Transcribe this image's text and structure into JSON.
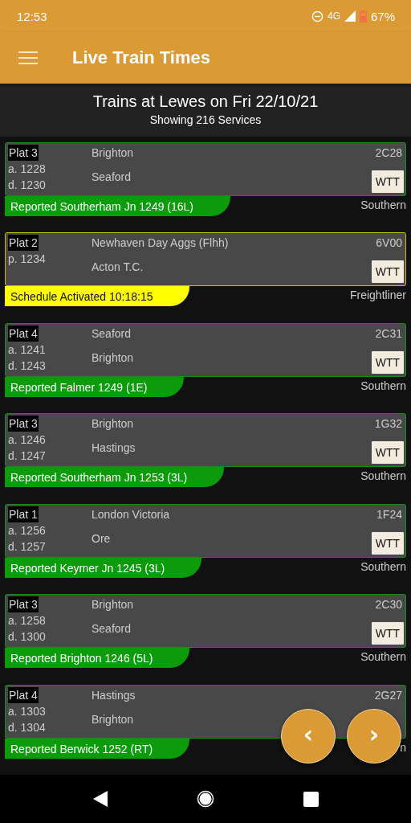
{
  "status_bar": {
    "time": "12:53",
    "network": "4G",
    "battery": "67%"
  },
  "app_bar": {
    "title": "Live Train Times"
  },
  "header": {
    "title": "Trains at Lewes on Fri 22/10/21",
    "subtitle": "Showing 216 Services"
  },
  "services": [
    {
      "platform": "Plat 3",
      "times": [
        "a. 1228",
        "d. 1230"
      ],
      "origin": "Brighton",
      "destination": "Seaford",
      "headcode": "2C28",
      "wtt": "WTT",
      "status": {
        "kind": "reported",
        "text": "Reported Southerham Jn 1249 (16L)"
      },
      "operator": "Southern"
    },
    {
      "platform": "Plat 2",
      "times": [
        "p. 1234"
      ],
      "origin": "Newhaven Day Aggs (Flhh)",
      "destination": "Acton T.C.",
      "headcode": "6V00",
      "wtt": "WTT",
      "status": {
        "kind": "activated",
        "text": "Schedule Activated 10:18:15"
      },
      "operator": "Freightliner"
    },
    {
      "platform": "Plat 4",
      "times": [
        "a. 1241",
        "d. 1243"
      ],
      "origin": "Seaford",
      "destination": "Brighton",
      "headcode": "2C31",
      "wtt": "WTT",
      "status": {
        "kind": "reported",
        "text": "Reported Falmer 1249 (1E)"
      },
      "operator": "Southern"
    },
    {
      "platform": "Plat 3",
      "times": [
        "a. 1246",
        "d. 1247"
      ],
      "origin": "Brighton",
      "destination": "Hastings",
      "headcode": "1G32",
      "wtt": "WTT",
      "status": {
        "kind": "reported",
        "text": "Reported Southerham Jn 1253 (3L)"
      },
      "operator": "Southern"
    },
    {
      "platform": "Plat 1",
      "times": [
        "a. 1256",
        "d. 1257"
      ],
      "origin": "London Victoria",
      "destination": "Ore",
      "headcode": "1F24",
      "wtt": "WTT",
      "status": {
        "kind": "reported",
        "text": "Reported Keymer Jn 1245 (3L)"
      },
      "operator": "Southern"
    },
    {
      "platform": "Plat 3",
      "times": [
        "a. 1258",
        "d. 1300"
      ],
      "origin": "Brighton",
      "destination": "Seaford",
      "headcode": "2C30",
      "wtt": "WTT",
      "status": {
        "kind": "reported",
        "text": "Reported Brighton 1246 (5L)"
      },
      "operator": "Southern"
    },
    {
      "platform": "Plat 4",
      "times": [
        "a. 1303",
        "d. 1304"
      ],
      "origin": "Hastings",
      "destination": "Brighton",
      "headcode": "2G27",
      "status": {
        "kind": "reported",
        "text": "Reported Berwick 1252 (RT)"
      },
      "operator": "n"
    }
  ],
  "pager": {
    "previous": "‹",
    "next": "›"
  }
}
